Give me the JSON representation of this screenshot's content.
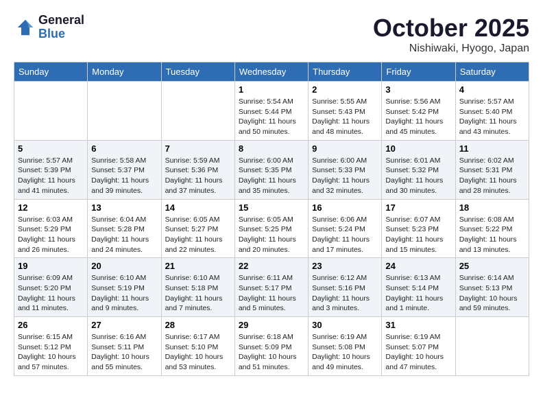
{
  "header": {
    "logo_line1": "General",
    "logo_line2": "Blue",
    "month": "October 2025",
    "location": "Nishiwaki, Hyogo, Japan"
  },
  "days_of_week": [
    "Sunday",
    "Monday",
    "Tuesday",
    "Wednesday",
    "Thursday",
    "Friday",
    "Saturday"
  ],
  "weeks": [
    {
      "days": [
        {
          "num": "",
          "info": ""
        },
        {
          "num": "",
          "info": ""
        },
        {
          "num": "",
          "info": ""
        },
        {
          "num": "1",
          "info": "Sunrise: 5:54 AM\nSunset: 5:44 PM\nDaylight: 11 hours\nand 50 minutes."
        },
        {
          "num": "2",
          "info": "Sunrise: 5:55 AM\nSunset: 5:43 PM\nDaylight: 11 hours\nand 48 minutes."
        },
        {
          "num": "3",
          "info": "Sunrise: 5:56 AM\nSunset: 5:42 PM\nDaylight: 11 hours\nand 45 minutes."
        },
        {
          "num": "4",
          "info": "Sunrise: 5:57 AM\nSunset: 5:40 PM\nDaylight: 11 hours\nand 43 minutes."
        }
      ]
    },
    {
      "days": [
        {
          "num": "5",
          "info": "Sunrise: 5:57 AM\nSunset: 5:39 PM\nDaylight: 11 hours\nand 41 minutes."
        },
        {
          "num": "6",
          "info": "Sunrise: 5:58 AM\nSunset: 5:37 PM\nDaylight: 11 hours\nand 39 minutes."
        },
        {
          "num": "7",
          "info": "Sunrise: 5:59 AM\nSunset: 5:36 PM\nDaylight: 11 hours\nand 37 minutes."
        },
        {
          "num": "8",
          "info": "Sunrise: 6:00 AM\nSunset: 5:35 PM\nDaylight: 11 hours\nand 35 minutes."
        },
        {
          "num": "9",
          "info": "Sunrise: 6:00 AM\nSunset: 5:33 PM\nDaylight: 11 hours\nand 32 minutes."
        },
        {
          "num": "10",
          "info": "Sunrise: 6:01 AM\nSunset: 5:32 PM\nDaylight: 11 hours\nand 30 minutes."
        },
        {
          "num": "11",
          "info": "Sunrise: 6:02 AM\nSunset: 5:31 PM\nDaylight: 11 hours\nand 28 minutes."
        }
      ]
    },
    {
      "days": [
        {
          "num": "12",
          "info": "Sunrise: 6:03 AM\nSunset: 5:29 PM\nDaylight: 11 hours\nand 26 minutes."
        },
        {
          "num": "13",
          "info": "Sunrise: 6:04 AM\nSunset: 5:28 PM\nDaylight: 11 hours\nand 24 minutes."
        },
        {
          "num": "14",
          "info": "Sunrise: 6:05 AM\nSunset: 5:27 PM\nDaylight: 11 hours\nand 22 minutes."
        },
        {
          "num": "15",
          "info": "Sunrise: 6:05 AM\nSunset: 5:25 PM\nDaylight: 11 hours\nand 20 minutes."
        },
        {
          "num": "16",
          "info": "Sunrise: 6:06 AM\nSunset: 5:24 PM\nDaylight: 11 hours\nand 17 minutes."
        },
        {
          "num": "17",
          "info": "Sunrise: 6:07 AM\nSunset: 5:23 PM\nDaylight: 11 hours\nand 15 minutes."
        },
        {
          "num": "18",
          "info": "Sunrise: 6:08 AM\nSunset: 5:22 PM\nDaylight: 11 hours\nand 13 minutes."
        }
      ]
    },
    {
      "days": [
        {
          "num": "19",
          "info": "Sunrise: 6:09 AM\nSunset: 5:20 PM\nDaylight: 11 hours\nand 11 minutes."
        },
        {
          "num": "20",
          "info": "Sunrise: 6:10 AM\nSunset: 5:19 PM\nDaylight: 11 hours\nand 9 minutes."
        },
        {
          "num": "21",
          "info": "Sunrise: 6:10 AM\nSunset: 5:18 PM\nDaylight: 11 hours\nand 7 minutes."
        },
        {
          "num": "22",
          "info": "Sunrise: 6:11 AM\nSunset: 5:17 PM\nDaylight: 11 hours\nand 5 minutes."
        },
        {
          "num": "23",
          "info": "Sunrise: 6:12 AM\nSunset: 5:16 PM\nDaylight: 11 hours\nand 3 minutes."
        },
        {
          "num": "24",
          "info": "Sunrise: 6:13 AM\nSunset: 5:14 PM\nDaylight: 11 hours\nand 1 minute."
        },
        {
          "num": "25",
          "info": "Sunrise: 6:14 AM\nSunset: 5:13 PM\nDaylight: 10 hours\nand 59 minutes."
        }
      ]
    },
    {
      "days": [
        {
          "num": "26",
          "info": "Sunrise: 6:15 AM\nSunset: 5:12 PM\nDaylight: 10 hours\nand 57 minutes."
        },
        {
          "num": "27",
          "info": "Sunrise: 6:16 AM\nSunset: 5:11 PM\nDaylight: 10 hours\nand 55 minutes."
        },
        {
          "num": "28",
          "info": "Sunrise: 6:17 AM\nSunset: 5:10 PM\nDaylight: 10 hours\nand 53 minutes."
        },
        {
          "num": "29",
          "info": "Sunrise: 6:18 AM\nSunset: 5:09 PM\nDaylight: 10 hours\nand 51 minutes."
        },
        {
          "num": "30",
          "info": "Sunrise: 6:19 AM\nSunset: 5:08 PM\nDaylight: 10 hours\nand 49 minutes."
        },
        {
          "num": "31",
          "info": "Sunrise: 6:19 AM\nSunset: 5:07 PM\nDaylight: 10 hours\nand 47 minutes."
        },
        {
          "num": "",
          "info": ""
        }
      ]
    }
  ]
}
